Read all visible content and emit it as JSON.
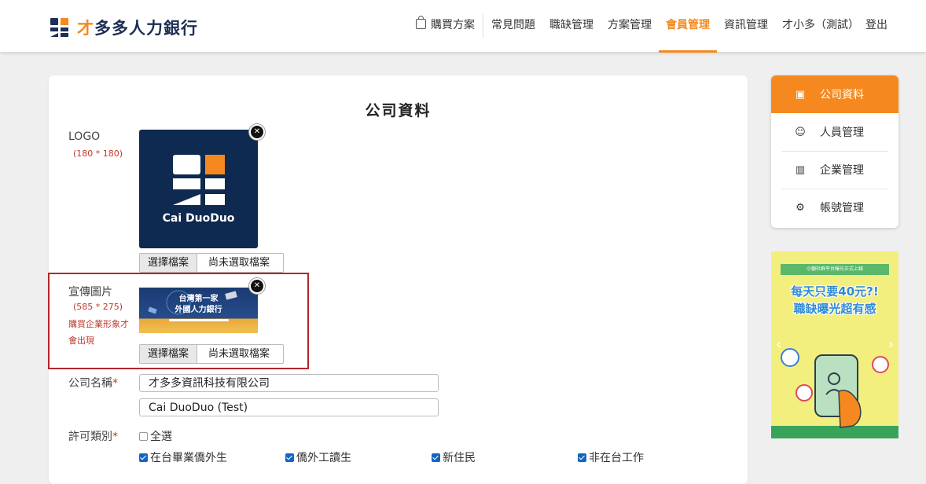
{
  "brand": {
    "name_accent": "才",
    "name_rest": "多多人力銀行"
  },
  "nav": [
    {
      "label": "購買方案",
      "icon": "shopping-bag-icon"
    },
    {
      "label": "常見問題"
    },
    {
      "label": "職缺管理"
    },
    {
      "label": "方案管理"
    },
    {
      "label": "會員管理",
      "active": true
    },
    {
      "label": "資訊管理"
    },
    {
      "label": "才小多（測試）"
    },
    {
      "label": "登出"
    }
  ],
  "form": {
    "title": "公司資料",
    "logo": {
      "label": "LOGO",
      "size_hint": "(180 * 180)",
      "preview_text": "Cai DuoDuo"
    },
    "promo": {
      "label": "宣傳圖片",
      "size_hint": "(585 * 275)",
      "note": "購買企業形象才會出現",
      "line1": "台灣第一家",
      "line2": "外國人力銀行"
    },
    "file": {
      "button": "選擇檔案",
      "status": "尚未選取檔案"
    },
    "company_name": {
      "label": "公司名稱",
      "required_mark": "*",
      "value_zh": "才多多資訊科技有限公司",
      "value_en": "Cai DuoDuo (Test)"
    },
    "permit": {
      "label": "許可類別",
      "required_mark": "*",
      "select_all": "全選",
      "options": [
        {
          "label": "在台畢業僑外生",
          "checked": true
        },
        {
          "label": "僑外工讀生",
          "checked": true
        },
        {
          "label": "新住民",
          "checked": true
        },
        {
          "label": "非在台工作",
          "checked": true
        }
      ]
    }
  },
  "sidebar": {
    "items": [
      {
        "label": "公司資料",
        "icon": "document-icon",
        "active": true
      },
      {
        "label": "人員管理",
        "icon": "people-icon"
      },
      {
        "label": "企業管理",
        "icon": "building-icon"
      },
      {
        "label": "帳號管理",
        "icon": "user-settings-icon"
      }
    ]
  },
  "ad": {
    "banner": "小額社群平台曝光正式上線",
    "headline1": "每天只要40元?!",
    "headline2": "職缺曝光超有感"
  },
  "colors": {
    "accent": "#f5891f",
    "brand_navy": "#1d2f55",
    "required_red": "#c0392b",
    "highlight_red": "#b3262b",
    "check_blue": "#1565c0"
  }
}
